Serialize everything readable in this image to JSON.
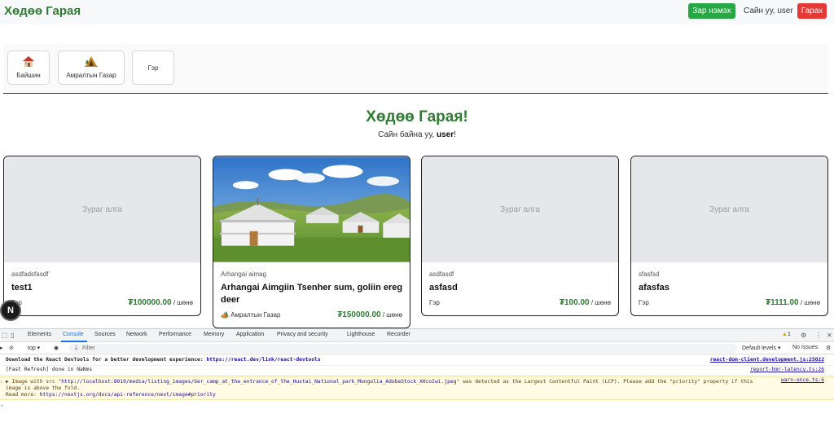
{
  "navbar": {
    "brand": "Хөдөө Гарая",
    "add_label": "Зар нэмэх",
    "greeting": "Сайн уу, user",
    "logout_label": "Гарах",
    "colors": {
      "brand": "#2e7d32",
      "add": "#28a745",
      "logout": "#e53935"
    }
  },
  "categories": [
    {
      "label": "Байшин",
      "icon": "house-icon"
    },
    {
      "label": "Амралтын Газар",
      "icon": "camping-icon"
    },
    {
      "label": "Гэр",
      "icon": ""
    }
  ],
  "hero": {
    "title": "Хөдөө Гарая!",
    "sub_prefix": "Сайн байна уу, ",
    "sub_user": "user",
    "sub_suffix": "!"
  },
  "listings": [
    {
      "image_placeholder": "Зураг алга",
      "location": "asdfadsfasdf",
      "title": "test1",
      "category": "Гэр",
      "price": "₮100000.00",
      "unit": " / шөнө"
    },
    {
      "image_placeholder": "",
      "location": "Arhangai aimag",
      "title": "Arhangai Aimgiin Tsenher sum, goliin ereg deer",
      "category": "🏕️ Амралтын Газар",
      "price": "₮150000.00",
      "unit": " / шөнө"
    },
    {
      "image_placeholder": "Зураг алга",
      "location": "asdfasdf",
      "title": "asfasd",
      "category": "Гэр",
      "price": "₮100.00",
      "unit": " / шөнө"
    },
    {
      "image_placeholder": "Зураг алга",
      "location": "sfasfsd",
      "title": "afasfas",
      "category": "Гэр",
      "price": "₮1111.00",
      "unit": " / шөнө"
    }
  ],
  "next_badge": "N",
  "devtools": {
    "tabs": [
      "Elements",
      "Console",
      "Sources",
      "Network",
      "Performance",
      "Memory",
      "Application",
      "Privacy and security",
      "Lighthouse",
      "Recorder"
    ],
    "active_tab": "Console",
    "issues_count": "1",
    "context": "top ▾",
    "filter_placeholder": "Filter",
    "levels": "Default levels ▾",
    "no_issues": "No Issues",
    "messages": [
      {
        "text_prefix": "Download the React DevTools for a better development experience: ",
        "link": "https://react.dev/link/react-devtools",
        "source": "react-dom-client.development.js:25022"
      },
      {
        "text": "[Fast Refresh] done in NaNms",
        "source": "report-hmr-latency.ts:26"
      },
      {
        "prefix": "▶ Image with src \"",
        "link": "http://localhost:8010/media/listing_images/Ger_camp_at_the_entrance_of_the_Hustai_National_park_Mongolia_AdobeStock_XHcoIwi.jpeg",
        "suffix": "\" was detected as the Largest Contentful Paint (LCP). Please add the \"priority\" property if this image is above the fold.",
        "readmore_prefix": "Read more: ",
        "readmore_link": "https://nextjs.org/docs/api-reference/next/image#priority",
        "source": "warn-once.ts:6"
      }
    ],
    "prompt": "›"
  }
}
